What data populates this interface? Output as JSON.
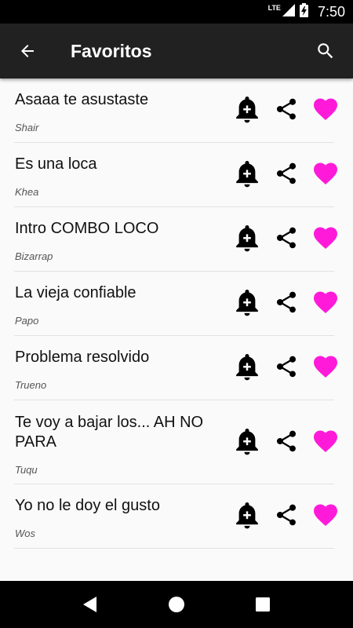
{
  "status_bar": {
    "network": "LTE",
    "time": "7:50"
  },
  "app_bar": {
    "title": "Favoritos"
  },
  "favorites": [
    {
      "title": "Asaaa te asustaste",
      "artist": "Shair"
    },
    {
      "title": "Es una loca",
      "artist": "Khea"
    },
    {
      "title": "Intro COMBO LOCO",
      "artist": "Bizarrap"
    },
    {
      "title": "La vieja confiable",
      "artist": "Papo"
    },
    {
      "title": "Problema resolvido",
      "artist": "Trueno"
    },
    {
      "title": "Te voy a bajar los... AH NO PARA",
      "artist": "Tuqu"
    },
    {
      "title": "Yo no le doy el gusto",
      "artist": "Wos"
    }
  ],
  "colors": {
    "heart": "#ff1ad9",
    "app_bar": "#212121",
    "background": "#fafafa"
  },
  "icons": [
    "back-arrow-icon",
    "search-icon",
    "add-alarm-bell-icon",
    "share-icon",
    "heart-icon",
    "nav-back-icon",
    "nav-home-icon",
    "nav-recents-icon"
  ]
}
